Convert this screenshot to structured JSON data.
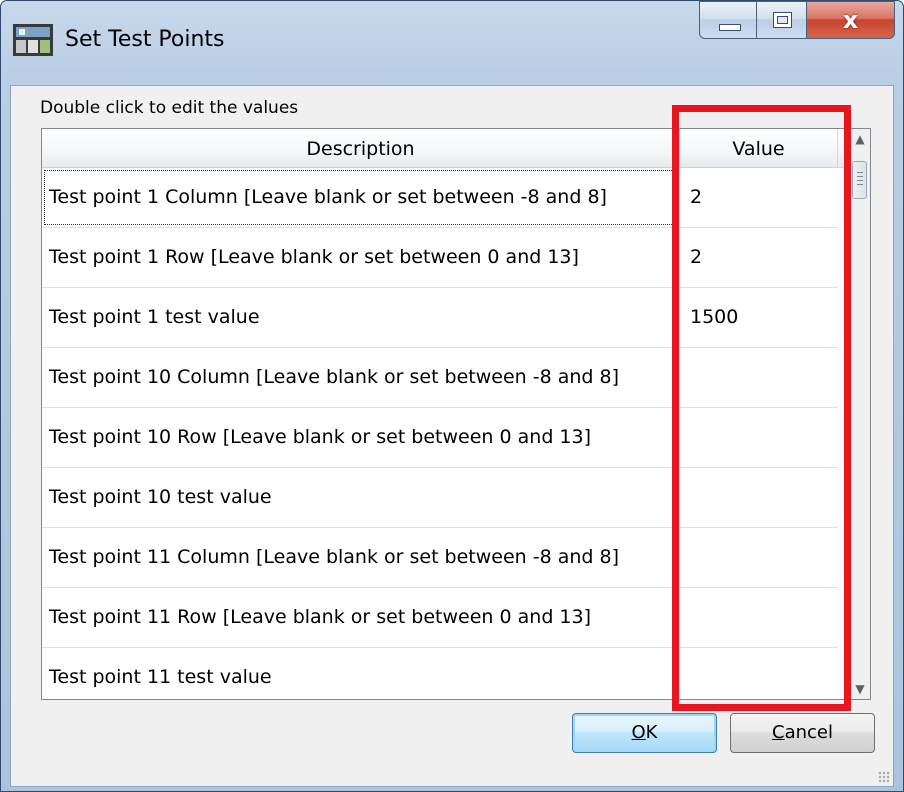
{
  "window": {
    "title": "Set Test Points",
    "app_icon": "app-icon",
    "controls": {
      "minimize_icon": "minimize-icon",
      "maximize_icon": "maximize-icon",
      "close_glyph": "x"
    }
  },
  "hint": "Double click to edit the values",
  "grid": {
    "columns": {
      "description": "Description",
      "value": "Value"
    },
    "rows": [
      {
        "description": "Test point 1 Column [Leave blank or set between -8 and 8]",
        "value": "2"
      },
      {
        "description": "Test point 1 Row [Leave blank or set between 0 and 13]",
        "value": "2"
      },
      {
        "description": "Test point 1 test value",
        "value": "1500"
      },
      {
        "description": "Test point 10 Column [Leave blank or set between -8 and 8]",
        "value": ""
      },
      {
        "description": "Test point 10 Row [Leave blank or set between 0 and 13]",
        "value": ""
      },
      {
        "description": "Test point 10 test value",
        "value": ""
      },
      {
        "description": "Test point 11 Column [Leave blank or set between -8 and 8]",
        "value": ""
      },
      {
        "description": "Test point 11 Row [Leave blank or set between 0 and 13]",
        "value": ""
      },
      {
        "description": "Test point 11 test value",
        "value": ""
      }
    ]
  },
  "buttons": {
    "ok": {
      "mnemonic": "O",
      "rest": "K"
    },
    "cancel": {
      "mnemonic": "C",
      "rest": "ancel"
    }
  },
  "annotation": {
    "color": "#e8161f"
  }
}
